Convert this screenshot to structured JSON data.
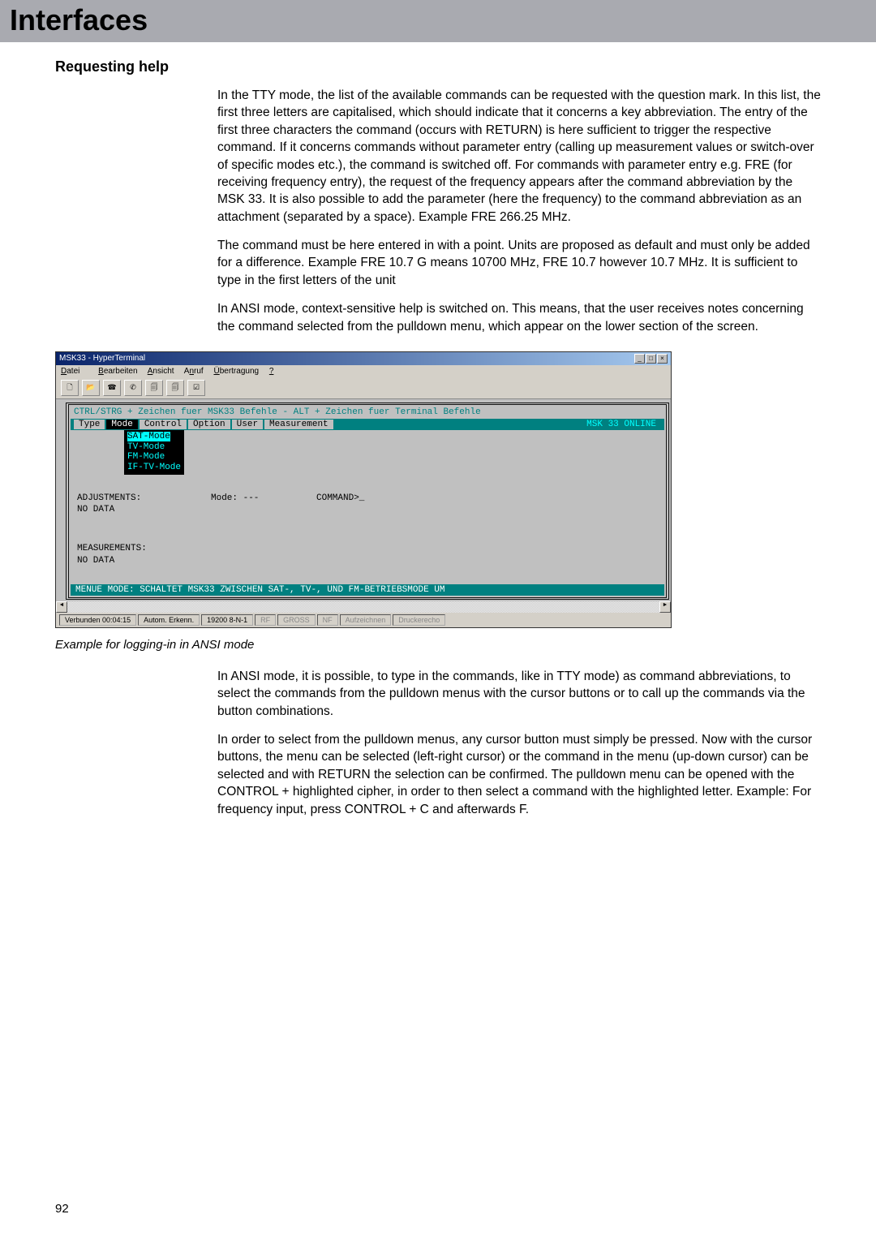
{
  "header": {
    "title": "Interfaces"
  },
  "section1": {
    "title": "Requesting help",
    "p1": "In the TTY mode, the list of the available commands can be requested with the question mark.  In this list, the first three letters are capitalised, which should indicate that it concerns a key abbreviation. The entry of the first three characters the command (occurs with RETURN) is here sufficient to trigger the respective command. If it concerns commands without parameter entry (calling up measurement values or switch-over of specific modes etc.),  the command is switched off. For commands with parameter entry e.g. FRE (for receiving frequency entry), the request of the frequency appears after the command abbreviation by the MSK 33.  It is also possible to add the parameter (here the frequency) to the command abbreviation as an attachment (separated by a space). Example FRE 266.25 MHz.",
    "p2": "The command must be here entered in with a point.  Units are proposed as default and must only be added for a difference. Example FRE 10.7 G means 10700 MHz, FRE 10.7 however 10.7 MHz. It is sufficient to type in the first letters of the unit",
    "p3": "In ANSI mode, context-sensitive help is switched on. This means, that the user receives notes concerning the command selected from the pulldown menu, which appear on the lower section of the screen."
  },
  "screenshot": {
    "window_title": "MSK33 - HyperTerminal",
    "menubar": [
      "Datei",
      "Bearbeiten",
      "Ansicht",
      "Anruf",
      "Übertragung",
      "?"
    ],
    "term_line1": "CTRL/STRG + Zeichen fuer MSK33 Befehle - ALT + Zeichen fuer Terminal Befehle",
    "term_menus": [
      "Type",
      "Mode",
      "Control",
      "Option",
      "User",
      "Measurement"
    ],
    "term_online": "MSK 33 ONLINE",
    "dropdown": [
      "SAT-Mode",
      "TV-Mode",
      "FM-Mode",
      "IF-TV-Mode"
    ],
    "body": {
      "mode_label": "Mode: ---",
      "command_label": "COMMAND>_",
      "adjustments": "ADJUSTMENTS:",
      "nodata1": "NO DATA",
      "measurements": "MEASUREMENTS:",
      "nodata2": "NO DATA"
    },
    "statusline": "MENUE MODE: SCHALTET MSK33 ZWISCHEN SAT-, TV-, UND FM-BETRIEBSMODE UM",
    "statusbar": {
      "time": "Verbunden 00:04:15",
      "detect": "Autom. Erkenn.",
      "baud": "19200 8-N-1",
      "rf": "RF",
      "caps": "GROSS",
      "num": "NF",
      "capture": "Aufzeichnen",
      "echo": "Druckerecho"
    }
  },
  "caption": "Example for logging-in in ANSI mode",
  "section2": {
    "p1": "In ANSI mode, it is possible, to type in the commands, like in TTY mode) as command abbreviations, to select the commands from the pulldown menus with the cursor buttons or to call up the commands via the button combinations.",
    "p2": "In order to select from the pulldown menus, any cursor button must simply be pressed. Now with the cursor buttons, the menu can be selected (left-right cursor) or the command in the menu (up-down cursor) can be selected and with RETURN the selection can be confirmed.  The pulldown menu can be opened with the CONTROL + highlighted cipher, in order to then select a command with the highlighted letter.  Example: For frequency input, press CONTROL + C and afterwards F."
  },
  "page_number": "92"
}
